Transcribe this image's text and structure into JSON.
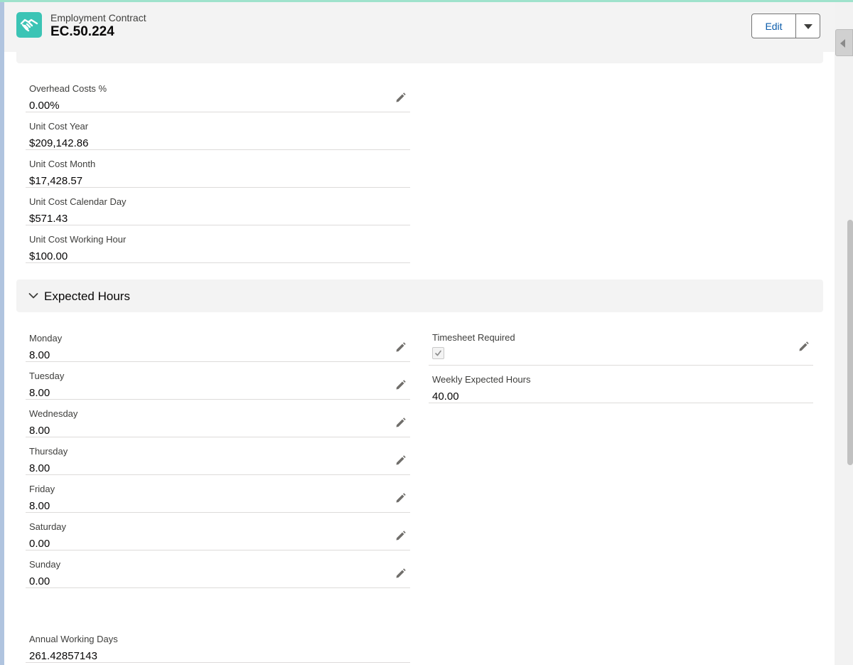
{
  "header": {
    "object_name": "Employment Contract",
    "record_title": "EC.50.224",
    "edit_label": "Edit",
    "record_icon": "handshake-icon"
  },
  "cost_fields": [
    {
      "label": "Overhead Costs %",
      "value": "0.00%",
      "editable": true
    },
    {
      "label": "Unit Cost Year",
      "value": "$209,142.86",
      "editable": false
    },
    {
      "label": "Unit Cost Month",
      "value": "$17,428.57",
      "editable": false
    },
    {
      "label": "Unit Cost Calendar Day",
      "value": "$571.43",
      "editable": false
    },
    {
      "label": "Unit Cost Working Hour",
      "value": "$100.00",
      "editable": false
    }
  ],
  "expected_hours": {
    "title": "Expected Hours",
    "days": [
      {
        "label": "Monday",
        "value": "8.00"
      },
      {
        "label": "Tuesday",
        "value": "8.00"
      },
      {
        "label": "Wednesday",
        "value": "8.00"
      },
      {
        "label": "Thursday",
        "value": "8.00"
      },
      {
        "label": "Friday",
        "value": "8.00"
      },
      {
        "label": "Saturday",
        "value": "0.00"
      },
      {
        "label": "Sunday",
        "value": "0.00"
      }
    ],
    "timesheet_required": {
      "label": "Timesheet Required",
      "checked": true
    },
    "weekly_expected_hours": {
      "label": "Weekly Expected Hours",
      "value": "40.00"
    },
    "annual_working_days": {
      "label": "Annual Working Days",
      "value": "261.42857143"
    }
  },
  "colors": {
    "accent": "#9fe2cc",
    "icon_bg": "#3bc4b5",
    "link_blue": "#0b5cab",
    "background": "#b0c4df"
  }
}
